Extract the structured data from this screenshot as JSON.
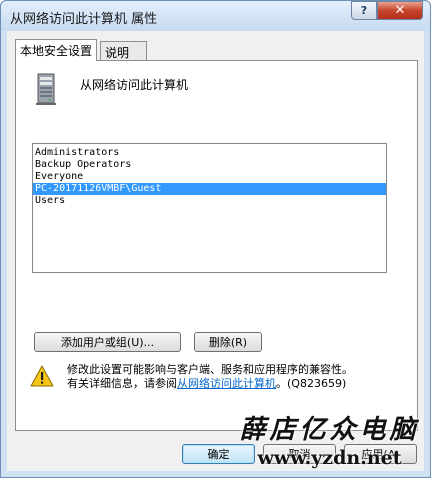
{
  "window": {
    "title": "从网络访问此计算机 属性",
    "help_label": "?",
    "close_label": "✕"
  },
  "tabs": [
    {
      "label": "本地安全设置",
      "active": true
    },
    {
      "label": "说明",
      "active": false
    }
  ],
  "policy": {
    "name": "从网络访问此计算机",
    "icon": "server-icon"
  },
  "accounts": [
    {
      "label": "Administrators",
      "selected": false
    },
    {
      "label": "Backup Operators",
      "selected": false
    },
    {
      "label": "Everyone",
      "selected": false
    },
    {
      "label": "PC-20171126VMBF\\Guest",
      "selected": true
    },
    {
      "label": "Users",
      "selected": false
    }
  ],
  "buttons": {
    "add": "添加用户或组(U)...",
    "remove": "删除(R)",
    "ok": "确定",
    "cancel": "取消",
    "apply": "应用(A)"
  },
  "warning": {
    "icon": "warning-icon",
    "line1": "修改此设置可能影响与客户端、服务和应用程序的兼容性。",
    "line2_prefix": "有关详细信息，请参阅",
    "link": "从网络访问此计算机",
    "line2_suffix": "。(Q823659)"
  },
  "watermark": {
    "text": "薛店亿众电脑",
    "url": "www.yzdn.net"
  },
  "colors": {
    "selection": "#3399ff",
    "link": "#0066cc",
    "close_button": "#c7442b"
  }
}
